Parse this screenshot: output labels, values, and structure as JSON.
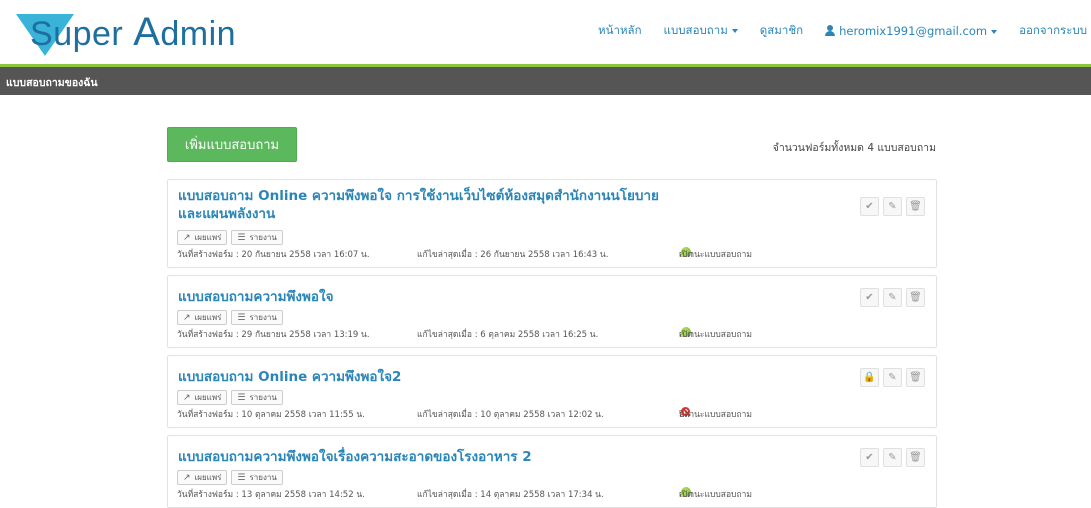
{
  "header": {
    "logo_first": "S",
    "logo_rest": "uper ",
    "logo_big": "A",
    "logo_tail": "dmin",
    "nav": {
      "home": "หน้าหลัก",
      "survey": "แบบสอบถาม",
      "members": "ดูสมาชิก",
      "user": "heromix1991@gmail.com",
      "logout": "ออกจากระบบ"
    }
  },
  "topbar": {
    "title": "แบบสอบถามของฉัน"
  },
  "actions": {
    "add_label": "เพิ่มแบบสอบถาม",
    "total_text": "จำนวนฟอร์มทั้งหมด 4 แบบสอบถาม"
  },
  "common": {
    "publish_label": "เผยแพร่",
    "report_label": "รายงาน"
  },
  "surveys": [
    {
      "title": "แบบสอบถาม Online ความพึงพอใจ การใช้งานเว็บไซต์ห้องสมุดสำนักงานนโยบายและแผนพลังงาน",
      "created": "วันที่สร้างฟอร์ม : 20 กันยายน 2558 เวลา 16:07 น.",
      "updated": "แก้ไขล่าสุดเมื่อ : 26 กันยายน 2558 เวลา 16:43 น.",
      "status_label": "สถานะแบบสอบถาม",
      "status": "เปิด",
      "open": true
    },
    {
      "title": "แบบสอบถามความพึงพอใจ",
      "created": "วันที่สร้างฟอร์ม : 29 กันยายน 2558 เวลา 13:19 น.",
      "updated": "แก้ไขล่าสุดเมื่อ : 6 ตุลาคม 2558 เวลา 16:25 น.",
      "status_label": "สถานะแบบสอบถาม",
      "status": "เปิด",
      "open": true
    },
    {
      "title": "แบบสอบถาม Online ความพึงพอใจ2",
      "created": "วันที่สร้างฟอร์ม : 10 ตุลาคม 2558 เวลา 11:55 น.",
      "updated": "แก้ไขล่าสุดเมื่อ : 10 ตุลาคม 2558 เวลา 12:02 น.",
      "status_label": "สถานะแบบสอบถาม",
      "status": "ปิด",
      "open": false
    },
    {
      "title": "แบบสอบถามความพึงพอใจเรื่องความสะอาดของโรงอาหาร 2",
      "created": "วันที่สร้างฟอร์ม : 13 ตุลาคม 2558 เวลา 14:52 น.",
      "updated": "แก้ไขล่าสุดเมื่อ : 14 ตุลาคม 2558 เวลา 17:34 น.",
      "status_label": "สถานะแบบสอบถาม",
      "status": "เปิด",
      "open": true
    }
  ],
  "colors": {
    "accent_green": "#5cb85c",
    "link_blue": "#2a86b8",
    "topbar_gray": "#555555",
    "topbar_line": "#8cc63f"
  }
}
